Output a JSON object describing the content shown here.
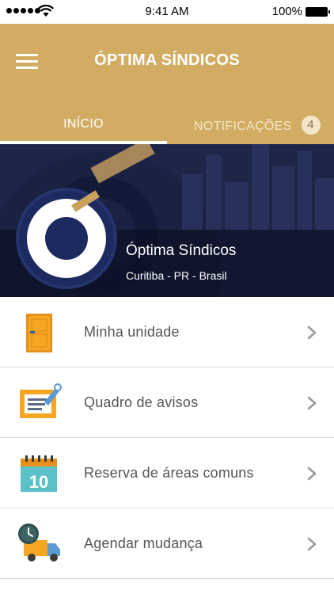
{
  "status_bar": {
    "time": "9:41 AM",
    "battery": "100%",
    "signal_icon": "signal-dots-icon",
    "wifi_icon": "wifi-icon",
    "battery_icon": "battery-icon"
  },
  "header": {
    "title": "ÓPTIMA SÍNDICOS",
    "menu_icon": "hamburger-menu-icon",
    "background_color": "#d2ac62",
    "tabs": [
      {
        "label": "INÍCIO",
        "active": true
      },
      {
        "label": "NOTIFICAÇÕES",
        "active": false,
        "badge": "4"
      }
    ]
  },
  "profile": {
    "name": "Óptima Síndicos",
    "location": "Curitiba - PR - Brasil",
    "banner_color": "#1d2548",
    "logo": "optima-logo"
  },
  "menu": {
    "items": [
      {
        "label": "Minha unidade",
        "icon": "door-icon"
      },
      {
        "label": "Quadro de avisos",
        "icon": "notice-board-icon"
      },
      {
        "label": "Reserva de áreas comuns",
        "icon": "calendar-icon"
      },
      {
        "label": "Agendar mudança",
        "icon": "moving-truck-icon"
      }
    ],
    "chevron_icon": "chevron-right-icon"
  }
}
